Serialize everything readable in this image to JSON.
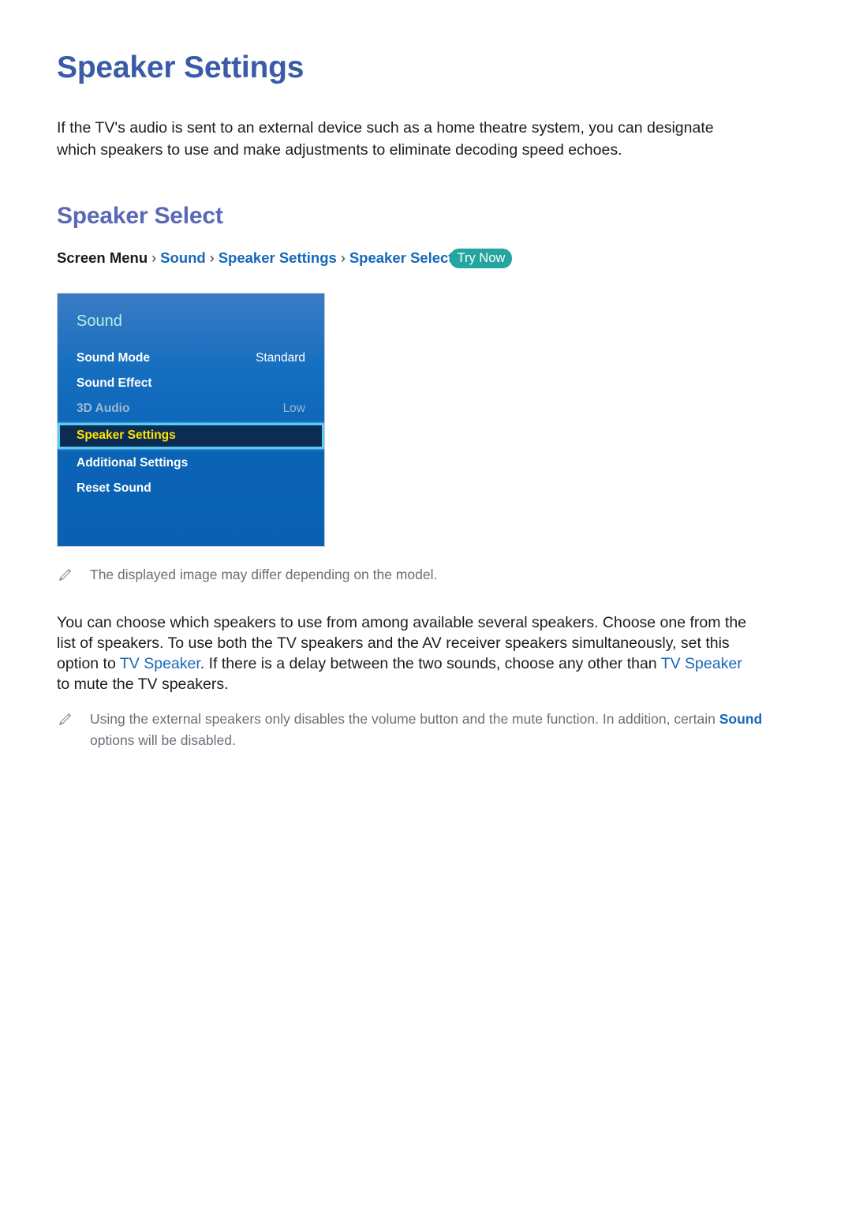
{
  "page": {
    "title": "Speaker Settings",
    "intro_line1": "If the TV's audio is sent to an external device such as a home theatre system, you can designate",
    "intro_line2": "which speakers to use and make adjustments to eliminate decoding speed echoes."
  },
  "section": {
    "heading": "Speaker Select"
  },
  "breadcrumb": {
    "root": "Screen Menu",
    "sep": "›",
    "item1": "Sound",
    "item2": "Speaker Settings",
    "item3": "Speaker Select",
    "badge": "Try Now",
    "badge_color": "#24a6a0",
    "link_color": "#1668b8"
  },
  "tv_menu": {
    "title": "Sound",
    "title_color": "#b9f0e6",
    "highlight_text_color": "#ffe600",
    "highlight_border_color": "#58cdf4",
    "highlight_bg_color": "#0d2c54",
    "rows": [
      {
        "label": "Sound Mode",
        "value": "Standard",
        "state": "normal"
      },
      {
        "label": "Sound Effect",
        "value": "",
        "state": "normal"
      },
      {
        "label": "3D Audio",
        "value": "Low",
        "state": "dimmed"
      },
      {
        "label": "Speaker Settings",
        "value": "",
        "state": "selected"
      },
      {
        "label": "Additional Settings",
        "value": "",
        "state": "normal"
      },
      {
        "label": "Reset Sound",
        "value": "",
        "state": "normal"
      }
    ]
  },
  "note_image": {
    "icon": "pencil-icon",
    "text": "The displayed image may differ depending on the model."
  },
  "body": {
    "line1": "You can choose which speakers to use from among available several speakers. Choose one from the",
    "line2": "list of speakers. To use both the TV speakers and the AV receiver speakers simultaneously, set this",
    "line3_a": "option to ",
    "line3_hl1": "TV Speaker",
    "line3_b": ". If there is a delay between the two sounds, choose any other than ",
    "line3_hl2": "TV Speaker",
    "line4": "to mute the TV speakers."
  },
  "note_external": {
    "icon": "pencil-icon",
    "text_a": "Using the external speakers only disables the volume button and the mute function. In addition, certain",
    "hl": "Sound",
    "text_b": " options will be disabled."
  }
}
